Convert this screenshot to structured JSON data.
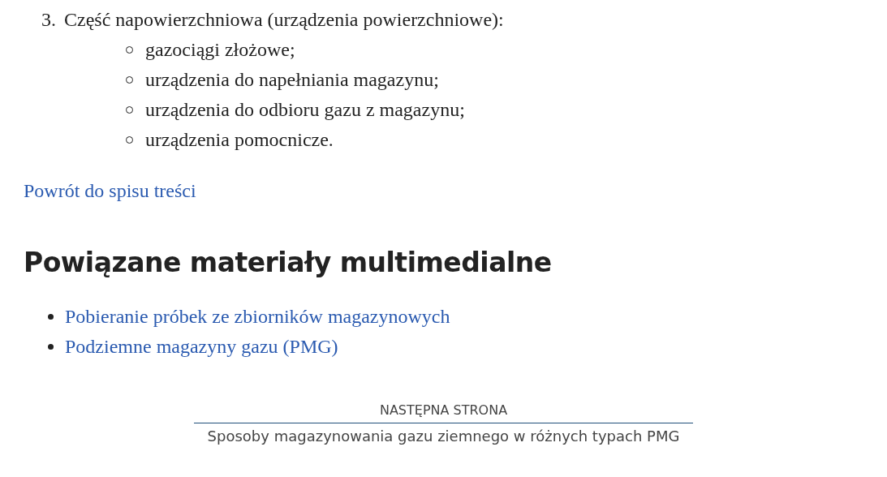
{
  "list_item": {
    "number": "3.",
    "text": "Część napowierzchniowa (urządzenia powierzchniowe):",
    "subitems": [
      "gazociągi złożowe;",
      "urządzenia do napełniania magazynu;",
      "urządzenia do odbioru gazu z magazynu;",
      "urządzenia pomocnicze."
    ]
  },
  "back_link": "Powrót do spisu treści",
  "related": {
    "heading": "Powiązane materiały multimedialne",
    "links": [
      "Pobieranie próbek ze zbiorników magazynowych",
      "Podziemne magazyny gazu (PMG)"
    ]
  },
  "next_page": {
    "label": "NASTĘPNA STRONA",
    "title": "Sposoby magazynowania gazu ziemnego w różnych typach PMG"
  }
}
